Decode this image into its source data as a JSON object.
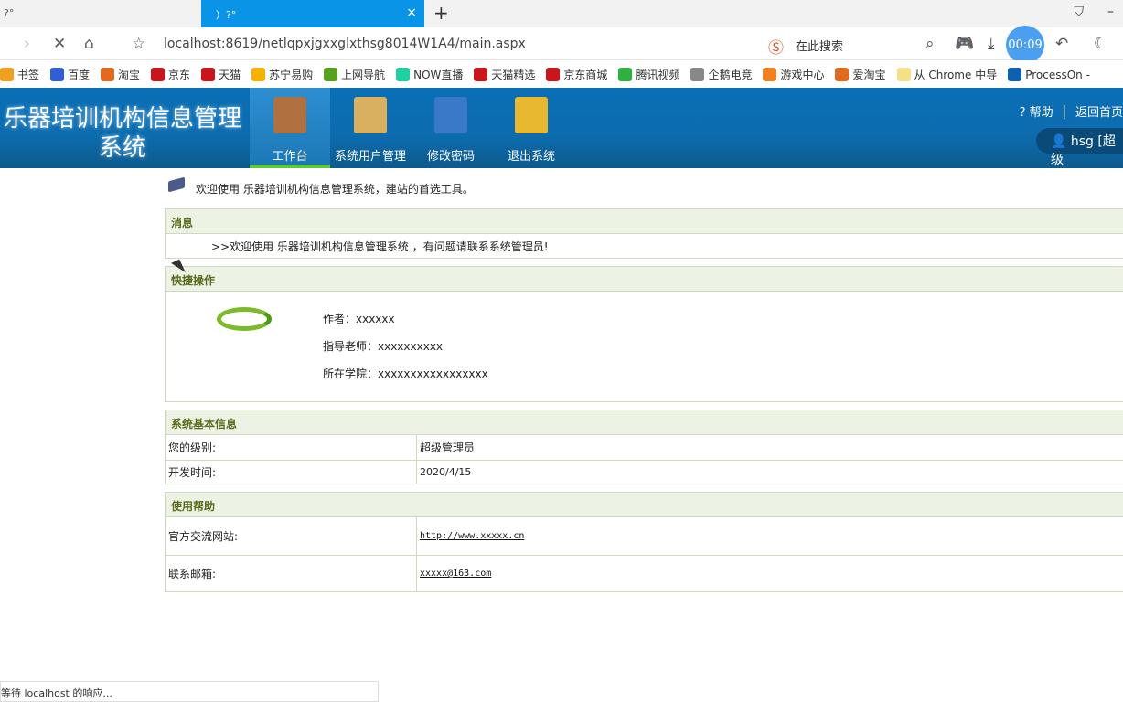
{
  "browser": {
    "tabs": [
      {
        "label": "?°"
      },
      {
        "label": "）?°",
        "active": true
      }
    ],
    "url": "localhost:8619/netlqpxjgxxglxthsg8014W1A4/main.aspx",
    "search_placeholder": "在此搜索",
    "timer": "00:09",
    "bookmarks": [
      {
        "label": "书签",
        "color": "#f0a020"
      },
      {
        "label": "百度",
        "color": "#3060d0"
      },
      {
        "label": "淘宝",
        "color": "#e06a20"
      },
      {
        "label": "京东",
        "color": "#c8161d"
      },
      {
        "label": "天猫",
        "color": "#c8161d"
      },
      {
        "label": "苏宁易购",
        "color": "#f5b000"
      },
      {
        "label": "上网导航",
        "color": "#5aa020"
      },
      {
        "label": "NOW直播",
        "color": "#20d0a0"
      },
      {
        "label": "天猫精选",
        "color": "#c8161d"
      },
      {
        "label": "京东商城",
        "color": "#c8161d"
      },
      {
        "label": "腾讯视频",
        "color": "#30b040"
      },
      {
        "label": "企鹅电竞",
        "color": "#888888"
      },
      {
        "label": "游戏中心",
        "color": "#f08020"
      },
      {
        "label": "爱淘宝",
        "color": "#e06a20"
      },
      {
        "label": "从 Chrome 中导",
        "color": "#f5e08a"
      },
      {
        "label": "ProcessOn -",
        "color": "#1060b0"
      }
    ],
    "status": "等待 localhost 的响应..."
  },
  "header": {
    "title_line1": "乐器培训机构信息管理",
    "title_line2": "系统",
    "nav": [
      {
        "label": "工作台",
        "icon": "book-icon",
        "color": "#b07040",
        "active": true
      },
      {
        "label": "系统用户管理",
        "icon": "ruler-triangle-icon",
        "color": "#d8b060"
      },
      {
        "label": "修改密码",
        "icon": "pencil-ruler-icon",
        "color": "#3a78c8"
      },
      {
        "label": "退出系统",
        "icon": "folder-download-icon",
        "color": "#e8b830"
      }
    ],
    "help": "帮助",
    "home": "返回首页",
    "user": "hsg [超级"
  },
  "main": {
    "welcome": "欢迎使用 乐器培训机构信息管理系统，建站的首选工具。",
    "message": {
      "title": "消息",
      "text": ">>欢迎使用 乐器培训机构信息管理系统 ，有问题请联系系统管理员!"
    },
    "quick": {
      "title": "快捷操作",
      "author": "作者：xxxxxx",
      "teacher": "指导老师：xxxxxxxxxx",
      "college": "所在学院：xxxxxxxxxxxxxxxxx"
    },
    "sysinfo": {
      "title": "系统基本信息",
      "rows": [
        {
          "label": "您的级别:",
          "value": "超级管理员"
        },
        {
          "label": "开发时间:",
          "value": "2020/4/15"
        }
      ]
    },
    "help": {
      "title": "使用帮助",
      "rows": [
        {
          "label": "官方交流网站:",
          "value": "http://www.xxxxx.cn"
        },
        {
          "label": "联系邮箱:",
          "value": "xxxxx@163.com"
        }
      ]
    }
  }
}
